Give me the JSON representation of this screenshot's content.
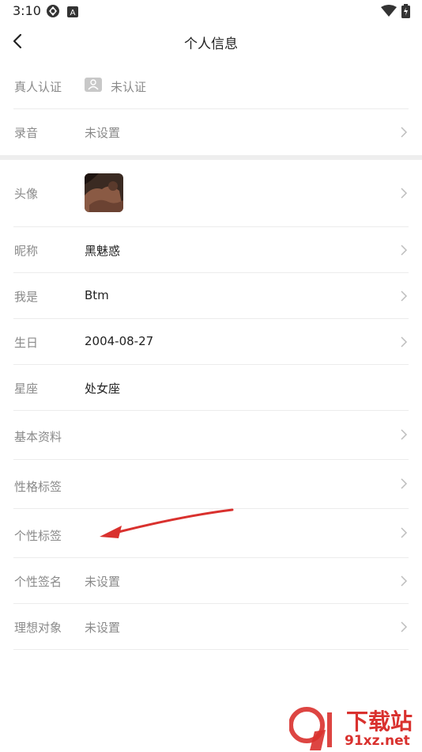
{
  "status_bar": {
    "time": "3:10",
    "icons": [
      "browser-icon",
      "a-badge-icon",
      "wifi-icon",
      "battery-icon"
    ]
  },
  "header": {
    "title": "个人信息",
    "back_icon": "chevron-left-icon"
  },
  "section_verify": [
    {
      "label": "真人认证",
      "value": "未认证",
      "icon": "person-verify-icon",
      "chevron": false
    },
    {
      "label": "录音",
      "value": "未设置",
      "chevron": true
    }
  ],
  "section_profile": {
    "avatar_label": "头像",
    "rows": [
      {
        "label": "昵称",
        "value": "黑魅惑"
      },
      {
        "label": "我是",
        "value": "Btm"
      },
      {
        "label": "生日",
        "value": "2004-08-27"
      },
      {
        "label": "星座",
        "value": "处女座"
      },
      {
        "label": "基本资料",
        "value": ""
      },
      {
        "label": "性格标签",
        "value": ""
      },
      {
        "label": "个性标签",
        "value": ""
      },
      {
        "label": "个性签名",
        "value": "未设置"
      },
      {
        "label": "理想对象",
        "value": "未设置"
      }
    ]
  },
  "annotation": {
    "arrow_color": "#d9312e"
  },
  "watermark": {
    "text": "下载站",
    "url_text": "91xz.net",
    "color": "#d9312e"
  }
}
